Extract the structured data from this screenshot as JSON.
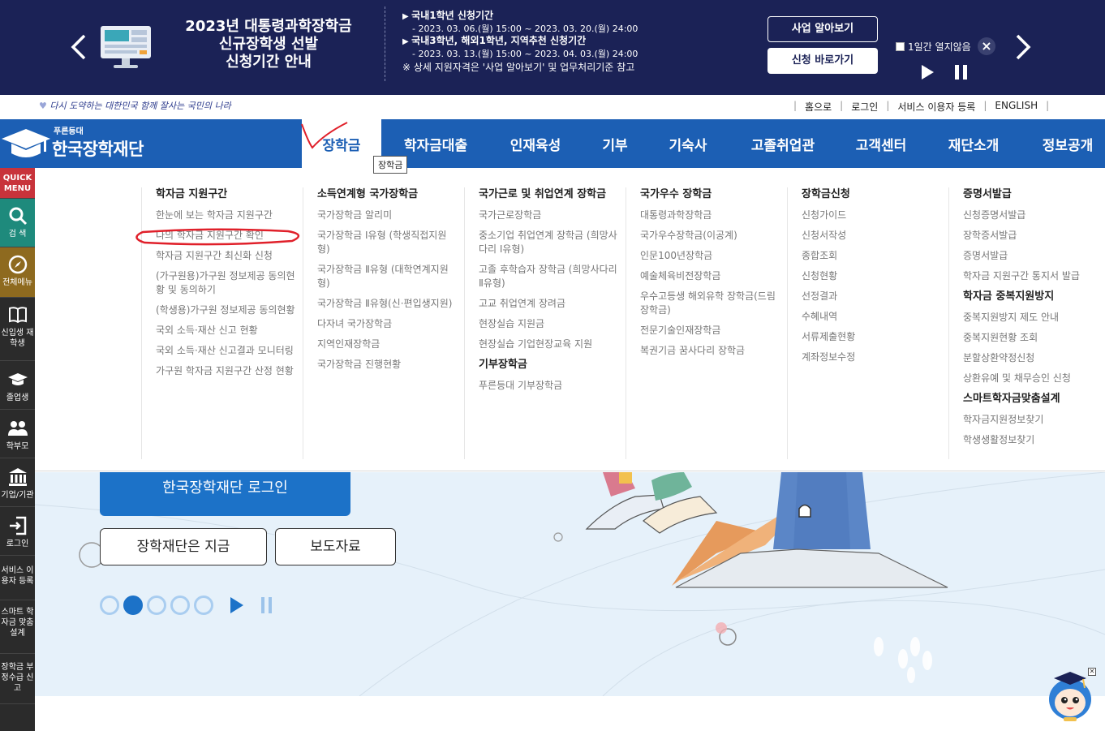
{
  "banner": {
    "title_lines": [
      "2023년 대통령과학장학금",
      "신규장학생 선발",
      "신청기간 안내"
    ],
    "info": [
      {
        "type": "h",
        "text": "국내1학년 신청기간"
      },
      {
        "type": "d",
        "text": "- 2023. 03. 06.(월) 15:00 ~ 2023. 03. 20.(월) 24:00"
      },
      {
        "type": "h",
        "text": "국내3학년, 해외1학년, 지역추천 신청기간"
      },
      {
        "type": "d",
        "text": "- 2023. 03. 13.(월) 15:00 ~ 2023. 04. 03.(월) 24:00"
      },
      {
        "type": "n",
        "text": "※ 상세 지원자격은 '사업 알아보기' 및 업무처리기준 참고"
      }
    ],
    "btn_about": "사업 알아보기",
    "btn_apply": "신청 바로가기",
    "no_show_label": "1일간 열지않음",
    "close_icon": "×"
  },
  "slogan": "다시 도약하는 대한민국 함께 잘사는 국민의 나라",
  "util": [
    "홈으로",
    "로그인",
    "서비스 이용자 등록",
    "ENGLISH"
  ],
  "logo": {
    "small": "푸른등대",
    "big": "한국장학재단"
  },
  "gnb": {
    "items": [
      "장학금",
      "학자금대출",
      "인재육성",
      "기부",
      "기숙사",
      "고졸취업관",
      "고객센터",
      "재단소개",
      "정보공개"
    ],
    "tooltip": "장학금"
  },
  "quick_menu": [
    {
      "label": "QUICK MENU",
      "icon": ""
    },
    {
      "label": "검 색",
      "icon": "search-icon"
    },
    {
      "label": "전체메뉴",
      "icon": "compass-icon"
    },
    {
      "label": "신입생 재학생",
      "icon": "book-icon"
    },
    {
      "label": "졸업생",
      "icon": "graduation-cap-icon"
    },
    {
      "label": "학부모",
      "icon": "people-icon"
    },
    {
      "label": "기업/기관",
      "icon": "building-icon"
    },
    {
      "label": "로그인",
      "icon": "login-icon"
    },
    {
      "label": "서비스 이용자 등록",
      "icon": ""
    },
    {
      "label": "스마트 학자금 맞춤설계",
      "icon": ""
    },
    {
      "label": "장학금 부정수급 신고",
      "icon": ""
    }
  ],
  "mega": [
    {
      "groups": [
        {
          "head": "학자금 지원구간",
          "links": [
            "한눈에 보는 학자금 지원구간",
            "나의 학자금 지원구간 확인",
            "학자금 지원구간 최신화 신청",
            "(가구원용)가구원 정보제공 동의현황 및 동의하기",
            "(학생용)가구원 정보제공 동의현황",
            "국외 소득·재산 신고 현황",
            "국외 소득·재산 신고결과 모니터링",
            "가구원 학자금 지원구간 산정 현황"
          ]
        }
      ]
    },
    {
      "groups": [
        {
          "head": "소득연계형 국가장학금",
          "links": [
            "국가장학금 알리미",
            "국가장학금 Ⅰ유형 (학생직접지원형)",
            "국가장학금 Ⅱ유형 (대학연계지원형)",
            "국가장학금 Ⅱ유형(신·편입생지원)",
            "다자녀 국가장학금",
            "지역인재장학금",
            "국가장학금 진행현황"
          ]
        }
      ]
    },
    {
      "groups": [
        {
          "head": "국가근로 및 취업연계 장학금",
          "links": [
            "국가근로장학금",
            "중소기업 취업연계 장학금 (희망사다리 Ⅰ유형)",
            "고졸 후학습자 장학금 (희망사다리 Ⅱ유형)",
            "고교 취업연계 장려금",
            "현장실습 지원금",
            "현장실습 기업현장교육 지원"
          ]
        },
        {
          "head": "기부장학금",
          "links": [
            "푸른등대 기부장학금"
          ]
        }
      ]
    },
    {
      "groups": [
        {
          "head": "국가우수 장학금",
          "links": [
            "대통령과학장학금",
            "국가우수장학금(이공계)",
            "인문100년장학금",
            "예술체육비전장학금",
            "우수고등생 해외유학 장학금(드림장학금)",
            "전문기술인재장학금",
            "복권기금 꿈사다리 장학금"
          ]
        }
      ]
    },
    {
      "groups": [
        {
          "head": "장학금신청",
          "links": [
            "신청가이드",
            "신청서작성",
            "종합조회",
            "신청현황",
            "선정결과",
            "수혜내역",
            "서류제출현황",
            "계좌정보수정"
          ]
        }
      ]
    },
    {
      "groups": [
        {
          "head": "증명서발급",
          "links": [
            "신청증명서발급",
            "장학증서발급",
            "증명서발급",
            "학자금 지원구간 통지서 발급"
          ]
        },
        {
          "head": "학자금 중복지원방지",
          "links": [
            "중복지원방지 제도 안내",
            "중복지원현황 조회",
            "분할상환약정신청",
            "상환유예 및 채무승인 신청"
          ]
        },
        {
          "head": "스마트학자금맞춤설계",
          "links": [
            "학자금지원정보찾기",
            "학생생활정보찾기"
          ]
        }
      ]
    }
  ],
  "hero": {
    "login_btn": "한국장학재단 로그인",
    "btn_now": "장학재단은 지금",
    "btn_press": "보도자료",
    "slides": 5,
    "active_slide": 2
  },
  "colors": {
    "navy": "#1b2256",
    "blue": "#1c5fb4",
    "accent_red": "#e0202a"
  }
}
